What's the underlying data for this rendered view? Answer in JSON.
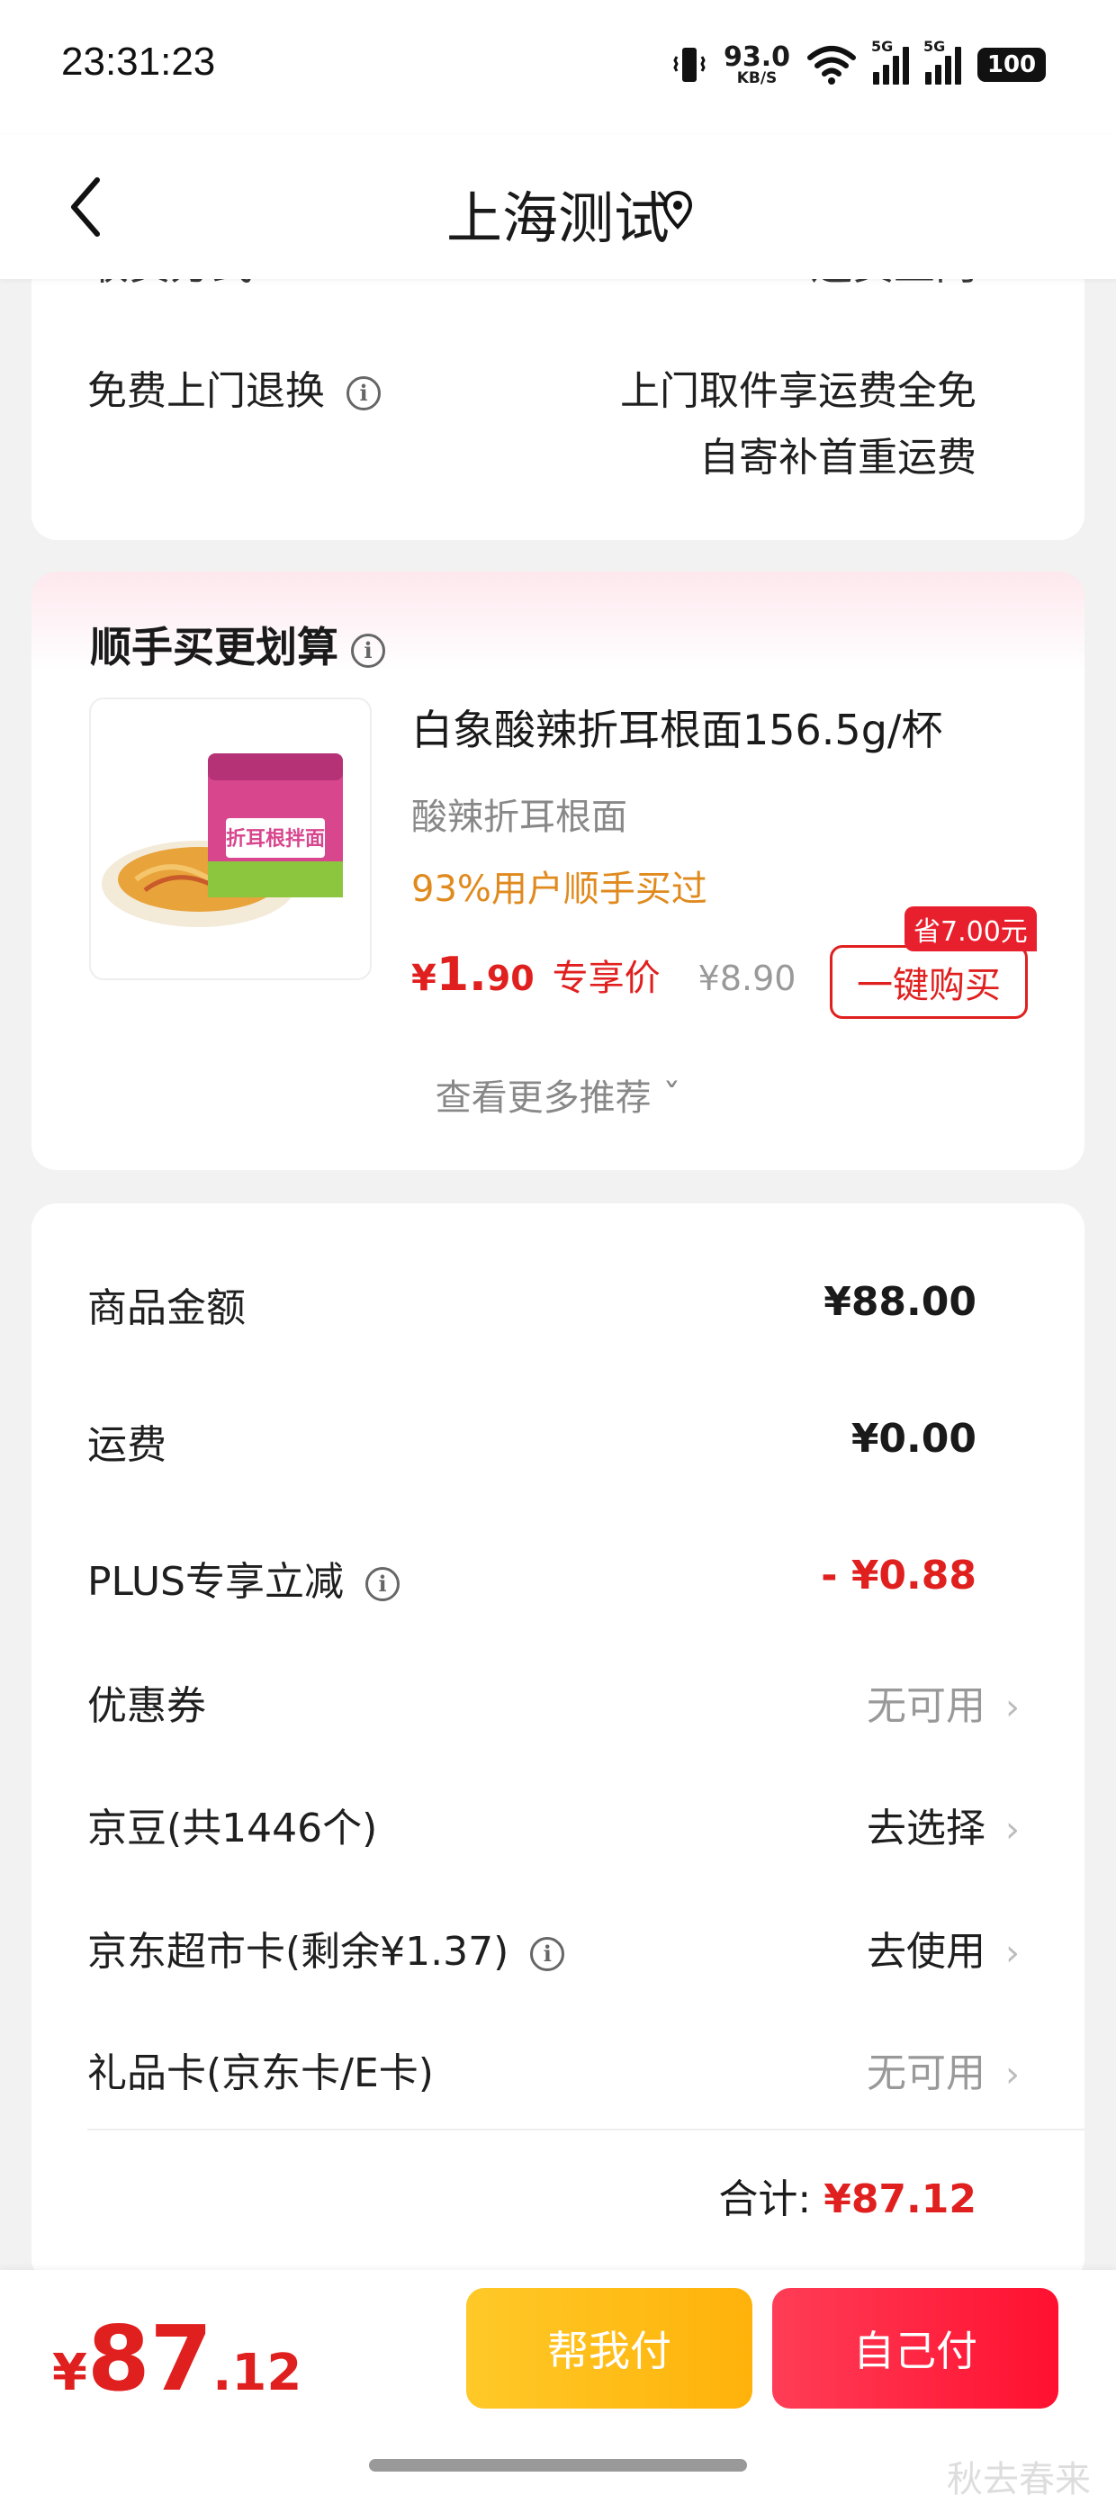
{
  "status_bar": {
    "time": "23:31:23",
    "net_speed": "93.0",
    "net_unit": "KB/S",
    "sig1_tag": "5G",
    "sig2_tag": "5G",
    "battery": "100"
  },
  "header": {
    "title": "上海测试"
  },
  "card1": {
    "peek_left": "收货方式",
    "peek_right": "送货上门",
    "free_return_label": "免费上门退换",
    "free_return_line1": "上门取件享运费全免",
    "free_return_line2": "自寄补首重运费"
  },
  "recommend": {
    "title": "顺手买更划算",
    "product_name": "白象酸辣折耳根面156.5g/杯",
    "product_sub": "酸辣折耳根面",
    "product_tag": "93%用户顺手买过",
    "price_yen": "¥",
    "price_int": "1.",
    "price_dec": "90",
    "exclusive": "专享价",
    "orig_price": "¥8.90",
    "save_badge": "省7.00元",
    "buy_label": "一键购买",
    "more": "查看更多推荐 ˇ",
    "package_text": "折耳根拌面"
  },
  "summary": {
    "rows": [
      {
        "label": "商品金额",
        "value": "¥88.00"
      },
      {
        "label": "运费",
        "value": "¥0.00"
      },
      {
        "label": "PLUS专享立减",
        "value": "- ¥0.88"
      },
      {
        "label": "优惠券",
        "value": "无可用"
      },
      {
        "label": "京豆(共1446个)",
        "value": "去选择"
      },
      {
        "label": "京东超市卡(剩余¥1.37)",
        "value": "去使用"
      },
      {
        "label": "礼品卡(京东卡/E卡)",
        "value": "无可用"
      }
    ],
    "total_label": "合计:",
    "total_value": "¥87.12"
  },
  "bottom": {
    "yen": "¥",
    "int": "87",
    "dec": ".12",
    "help_pay": "帮我付",
    "self_pay": "自己付",
    "watermark": "秋去春来"
  },
  "colors": {
    "accent_red": "#e0201f",
    "orange": "#e08a1e",
    "help_btn": "#ffb20a",
    "self_btn": "#ff1030"
  }
}
